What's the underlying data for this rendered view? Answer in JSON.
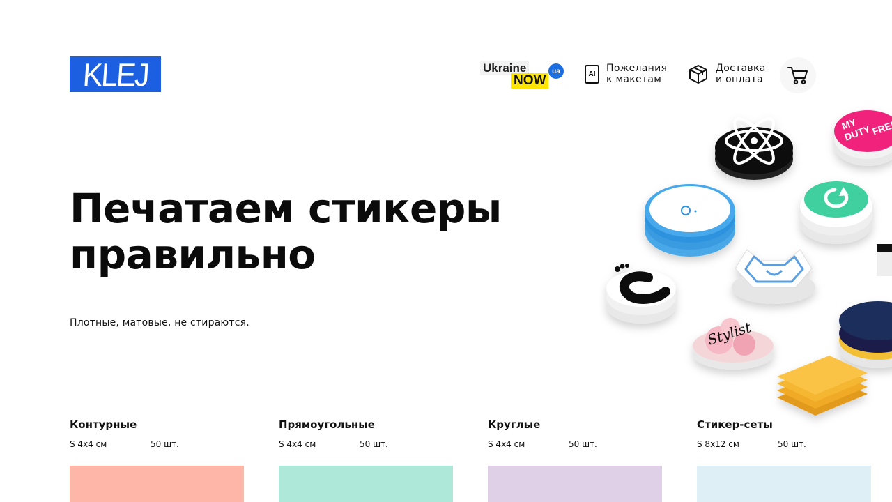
{
  "header": {
    "logo_text": "KLEJ",
    "ukraine_now": {
      "word1": "Ukraine",
      "word2": "NOW",
      "badge": "ua"
    },
    "nav": [
      {
        "line1": "Пожелания",
        "line2": "к макетам",
        "icon": "ai-file-icon",
        "icon_text": "AI"
      },
      {
        "line1": "Доставка",
        "line2": "и оплата",
        "icon": "box-icon"
      }
    ],
    "cart_icon": "cart-icon"
  },
  "hero": {
    "title_line1": "Печатаем стикеры",
    "title_line2": "правильно",
    "subtitle": "Плотные, матовые, не стираются."
  },
  "stickers_art": {
    "texts": {
      "duty": [
        "MY",
        "DUTY",
        "FREE"
      ],
      "stylish": "Stylist"
    }
  },
  "categories": [
    {
      "name": "Контурные",
      "size": "S 4х4 см",
      "qty": "50 шт.",
      "color": "#fdb6a8"
    },
    {
      "name": "Прямоугольные",
      "size": "S 4х4 см",
      "qty": "50 шт.",
      "color": "#ade8d9"
    },
    {
      "name": "Круглые",
      "size": "S 4х4 см",
      "qty": "50 шт.",
      "color": "#dfd0e8"
    },
    {
      "name": "Стикер-сеты",
      "size": "S 8х12 см",
      "qty": "50 шт.",
      "color": "#def0f5"
    }
  ],
  "colors": {
    "brand_blue": "#1c5fe0",
    "ua_yellow": "#ffe600",
    "text": "#111111"
  }
}
